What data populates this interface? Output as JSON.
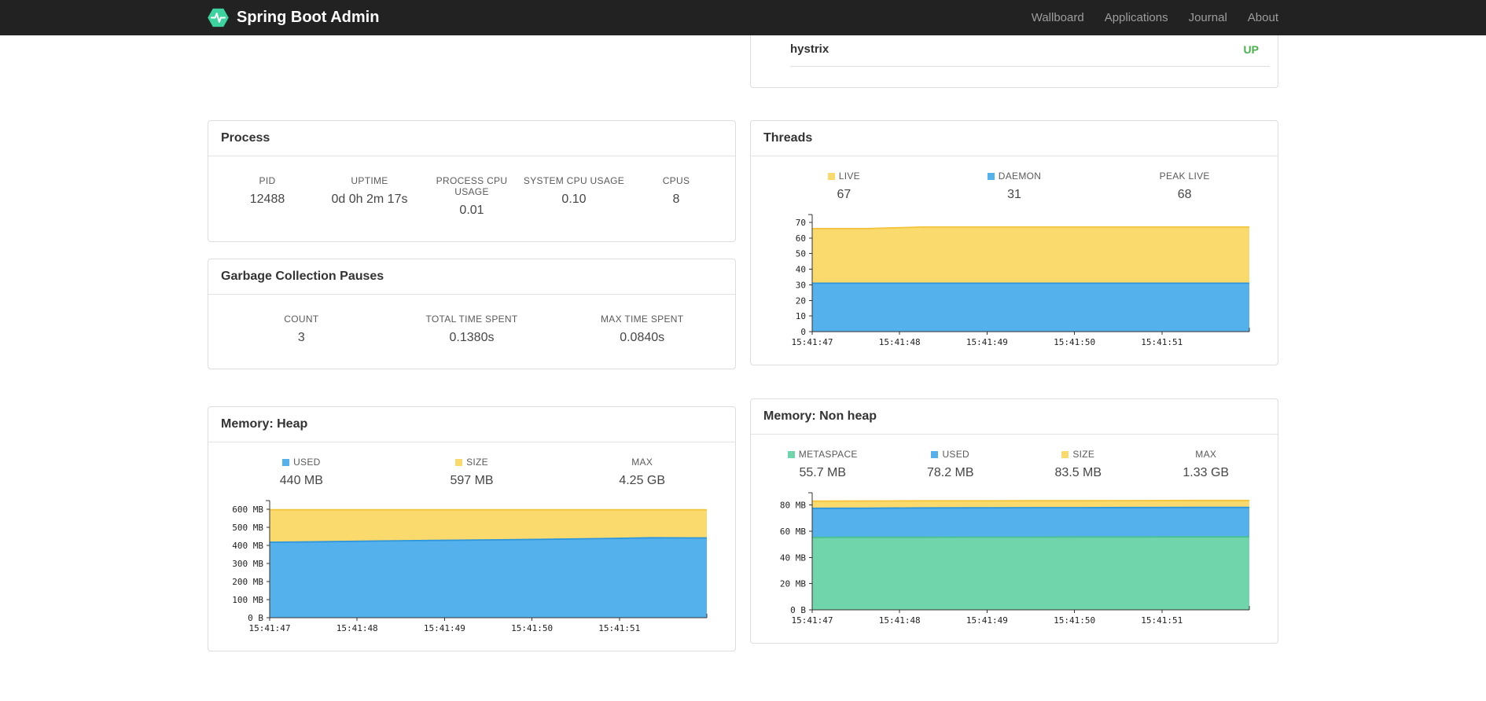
{
  "navbar": {
    "brand": "Spring Boot Admin",
    "links": [
      {
        "label": "Wallboard"
      },
      {
        "label": "Applications"
      },
      {
        "label": "Journal"
      },
      {
        "label": "About"
      }
    ]
  },
  "colors": {
    "navbar_bg": "#222222",
    "brand_green": "#3dd39e",
    "status_up": "#47b34b",
    "chart_yellow": "#fbda6d",
    "chart_blue": "#55b1eb",
    "chart_green": "#70d5aa"
  },
  "health": {
    "service": "hystrix",
    "status": "UP"
  },
  "process": {
    "title": "Process",
    "stats": [
      {
        "label": "PID",
        "value": "12488"
      },
      {
        "label": "UPTIME",
        "value": "0d 0h 2m 17s"
      },
      {
        "label": "PROCESS CPU USAGE",
        "value": "0.01"
      },
      {
        "label": "SYSTEM CPU USAGE",
        "value": "0.10"
      },
      {
        "label": "CPUS",
        "value": "8"
      }
    ]
  },
  "gc": {
    "title": "Garbage Collection Pauses",
    "stats": [
      {
        "label": "COUNT",
        "value": "3"
      },
      {
        "label": "TOTAL TIME SPENT",
        "value": "0.1380s"
      },
      {
        "label": "MAX TIME SPENT",
        "value": "0.0840s"
      }
    ]
  },
  "threads": {
    "title": "Threads",
    "stats": [
      {
        "label": "LIVE",
        "value": "67",
        "color": "#fbda6d"
      },
      {
        "label": "DAEMON",
        "value": "31",
        "color": "#55b1eb"
      },
      {
        "label": "PEAK LIVE",
        "value": "68"
      }
    ]
  },
  "heap": {
    "title": "Memory: Heap",
    "stats": [
      {
        "label": "USED",
        "value": "440 MB",
        "color": "#55b1eb"
      },
      {
        "label": "SIZE",
        "value": "597 MB",
        "color": "#fbda6d"
      },
      {
        "label": "MAX",
        "value": "4.25 GB"
      }
    ]
  },
  "nonheap": {
    "title": "Memory: Non heap",
    "stats": [
      {
        "label": "METASPACE",
        "value": "55.7 MB",
        "color": "#70d5aa"
      },
      {
        "label": "USED",
        "value": "78.2 MB",
        "color": "#55b1eb"
      },
      {
        "label": "SIZE",
        "value": "83.5 MB",
        "color": "#fbda6d"
      },
      {
        "label": "MAX",
        "value": "1.33 GB"
      }
    ]
  },
  "chart_data": [
    {
      "id": "threads",
      "type": "area",
      "title": "Threads",
      "ymax": 73,
      "yticks": [
        {
          "v": 0,
          "label": "0"
        },
        {
          "v": 10,
          "label": "10"
        },
        {
          "v": 20,
          "label": "20"
        },
        {
          "v": 30,
          "label": "30"
        },
        {
          "v": 40,
          "label": "40"
        },
        {
          "v": 50,
          "label": "50"
        },
        {
          "v": 60,
          "label": "60"
        },
        {
          "v": 70,
          "label": "70"
        }
      ],
      "xticks": [
        "15:41:47",
        "15:41:48",
        "15:41:49",
        "15:41:50",
        "15:41:51"
      ],
      "series": [
        {
          "name": "LIVE",
          "color": "#fbda6d",
          "line": "#f3c33c",
          "values": [
            66,
            66,
            67,
            67,
            67,
            67,
            67,
            67,
            67
          ]
        },
        {
          "name": "DAEMON",
          "color": "#55b1eb",
          "line": "#2e96dd",
          "values": [
            31,
            31,
            31,
            31,
            31,
            31,
            31,
            31,
            31
          ]
        }
      ]
    },
    {
      "id": "heap",
      "type": "area",
      "title": "Memory: Heap (MB)",
      "ymax": 630,
      "yticks": [
        {
          "v": 0,
          "label": "0 B"
        },
        {
          "v": 100,
          "label": "100 MB"
        },
        {
          "v": 200,
          "label": "200 MB"
        },
        {
          "v": 300,
          "label": "300 MB"
        },
        {
          "v": 400,
          "label": "400 MB"
        },
        {
          "v": 500,
          "label": "500 MB"
        },
        {
          "v": 600,
          "label": "600 MB"
        }
      ],
      "xticks": [
        "15:41:47",
        "15:41:48",
        "15:41:49",
        "15:41:50",
        "15:41:51"
      ],
      "series": [
        {
          "name": "SIZE",
          "color": "#fbda6d",
          "line": "#f3c33c",
          "values": [
            597,
            597,
            597,
            597,
            597,
            597,
            597,
            597,
            597
          ]
        },
        {
          "name": "USED",
          "color": "#55b1eb",
          "line": "#2e96dd",
          "values": [
            417,
            420,
            424,
            427,
            430,
            433,
            437,
            442,
            441
          ]
        }
      ]
    },
    {
      "id": "nonheap",
      "type": "area",
      "title": "Memory: Non heap (MB)",
      "ymax": 87,
      "yticks": [
        {
          "v": 0,
          "label": "0 B"
        },
        {
          "v": 20,
          "label": "20 MB"
        },
        {
          "v": 40,
          "label": "40 MB"
        },
        {
          "v": 60,
          "label": "60 MB"
        },
        {
          "v": 80,
          "label": "80 MB"
        }
      ],
      "xticks": [
        "15:41:47",
        "15:41:48",
        "15:41:49",
        "15:41:50",
        "15:41:51"
      ],
      "series": [
        {
          "name": "SIZE",
          "color": "#fbda6d",
          "line": "#f3c33c",
          "values": [
            83.0,
            83.1,
            83.2,
            83.2,
            83.3,
            83.3,
            83.4,
            83.5,
            83.5
          ]
        },
        {
          "name": "USED",
          "color": "#55b1eb",
          "line": "#2e96dd",
          "values": [
            77.5,
            77.6,
            77.8,
            77.9,
            78.0,
            78.0,
            78.1,
            78.2,
            78.2
          ]
        },
        {
          "name": "METASPACE",
          "color": "#70d5aa",
          "line": "#49c193",
          "values": [
            55.3,
            55.4,
            55.4,
            55.5,
            55.5,
            55.6,
            55.6,
            55.7,
            55.7
          ]
        }
      ]
    }
  ]
}
